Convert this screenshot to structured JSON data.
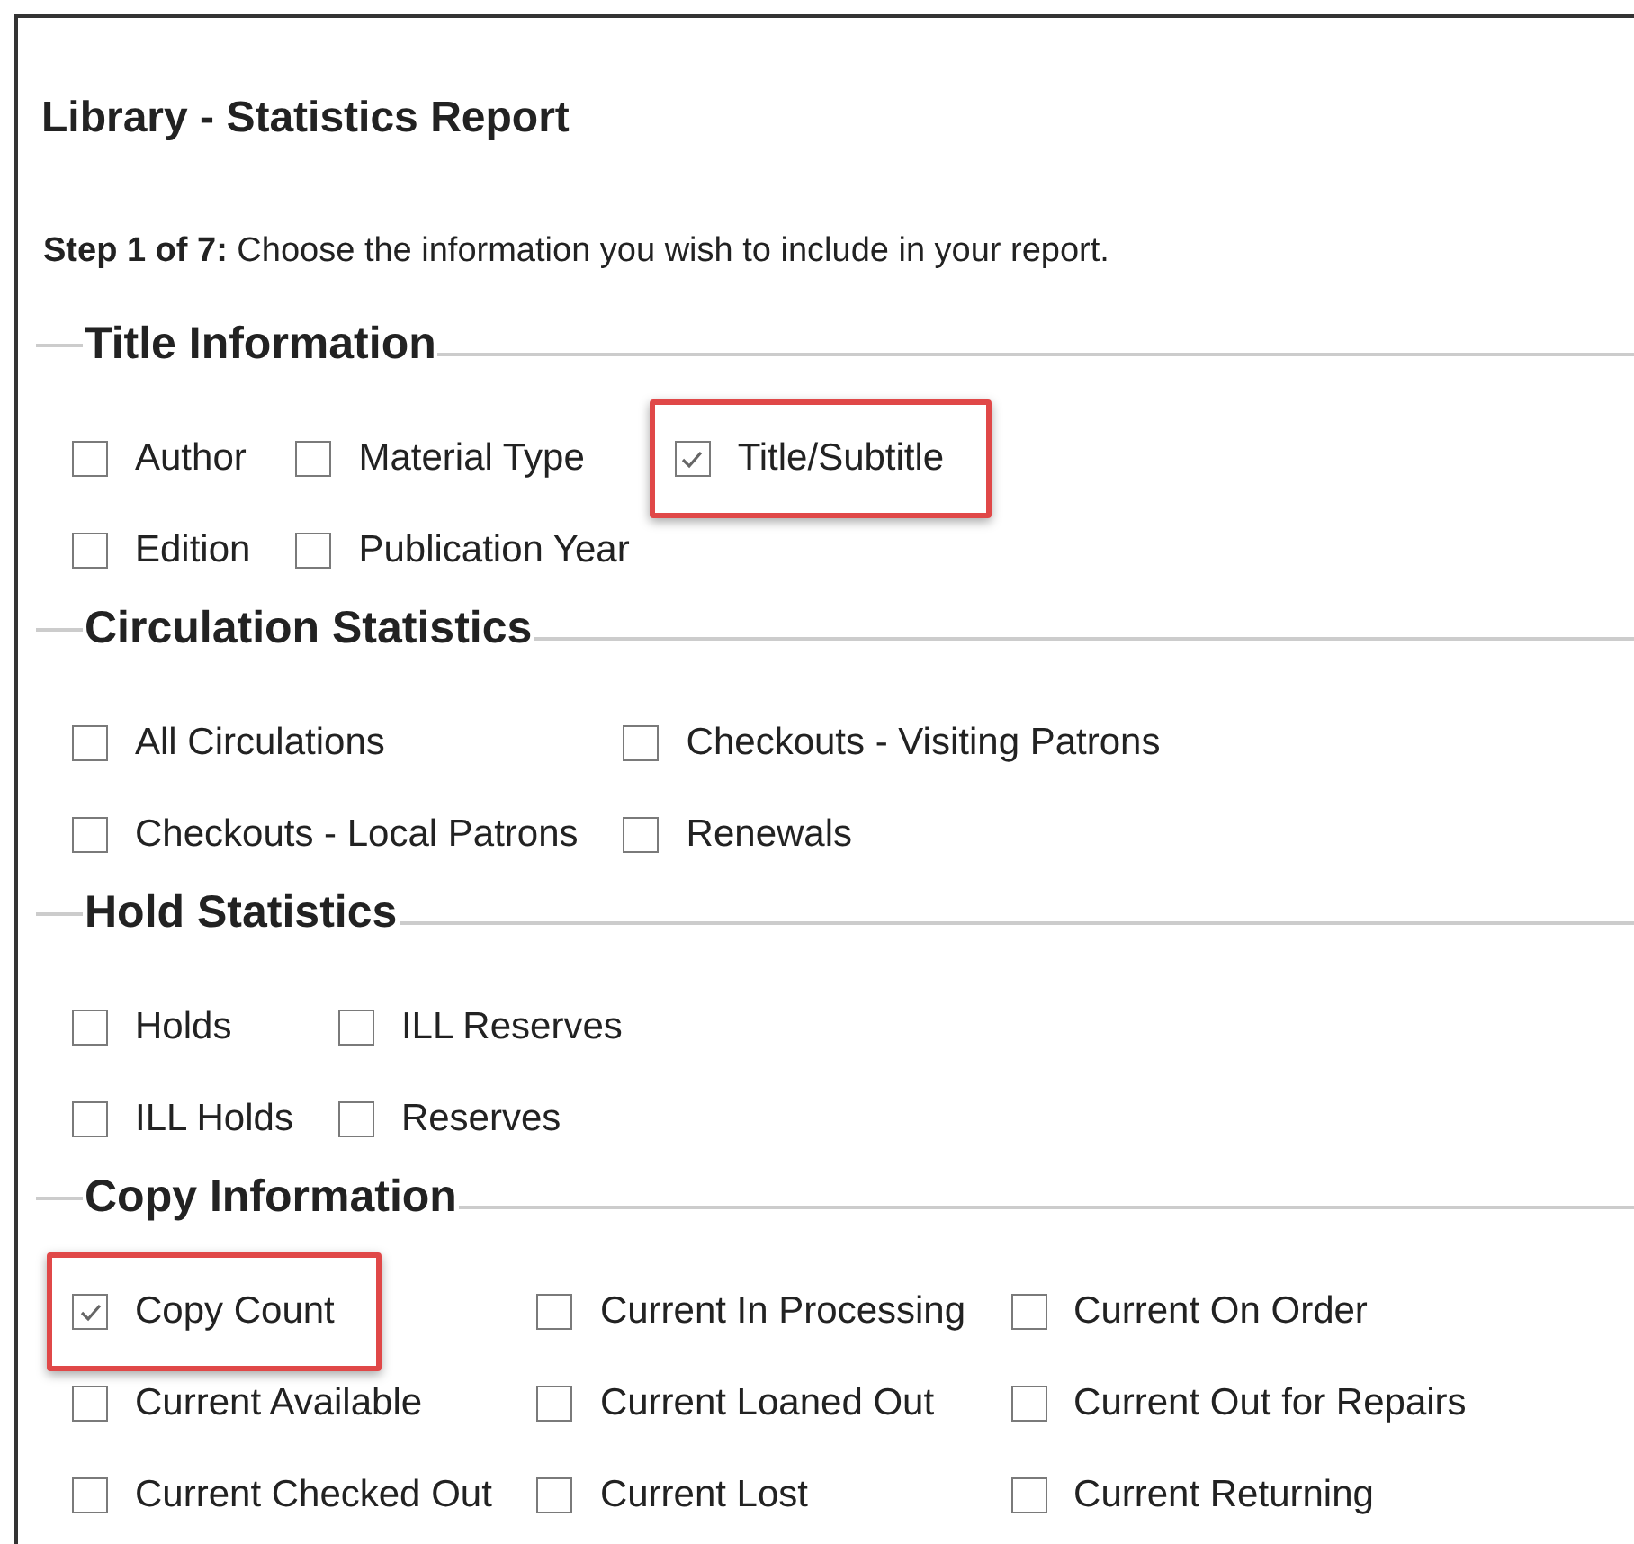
{
  "title": "Library - Statistics Report",
  "step_text": "**Step 1 of 7:** Choose the information you wish to include in your report.",
  "sections": [
    {
      "title": "Title Information",
      "rows": [
        [
          {
            "label": "Author",
            "checked": false,
            "highlighted": false
          },
          {
            "label": "Material Type",
            "checked": false,
            "highlighted": false
          },
          {
            "label": "Title/Subtitle",
            "checked": true,
            "highlighted": true
          }
        ],
        [
          {
            "label": "Edition",
            "checked": false,
            "highlighted": false
          },
          {
            "label": "Publication Year",
            "checked": false,
            "highlighted": false
          }
        ]
      ]
    },
    {
      "title": "Circulation Statistics",
      "rows": [
        [
          {
            "label": "All Circulations",
            "checked": false,
            "highlighted": false
          },
          {
            "label": "Checkouts - Visiting Patrons",
            "checked": false,
            "highlighted": false
          }
        ],
        [
          {
            "label": "Checkouts - Local Patrons",
            "checked": false,
            "highlighted": false
          },
          {
            "label": "Renewals",
            "checked": false,
            "highlighted": false
          }
        ]
      ]
    },
    {
      "title": "Hold Statistics",
      "rows": [
        [
          {
            "label": "Holds",
            "checked": false,
            "highlighted": false
          },
          {
            "label": "ILL Reserves",
            "checked": false,
            "highlighted": false
          }
        ],
        [
          {
            "label": "ILL Holds",
            "checked": false,
            "highlighted": false
          },
          {
            "label": "Reserves",
            "checked": false,
            "highlighted": false
          }
        ]
      ]
    },
    {
      "title": "Copy Information",
      "rows": [
        [
          {
            "label": "Copy Count",
            "checked": true,
            "highlighted": true
          },
          {
            "label": "Current In Processing",
            "checked": false,
            "highlighted": false
          },
          {
            "label": "Current On Order",
            "checked": false,
            "highlighted": false
          }
        ],
        [
          {
            "label": "Current Available",
            "checked": false,
            "highlighted": false
          },
          {
            "label": "Current Loaned Out",
            "checked": false,
            "highlighted": false
          },
          {
            "label": "Current Out for Repairs",
            "checked": false,
            "highlighted": false
          }
        ],
        [
          {
            "label": "Current Checked Out",
            "checked": false,
            "highlighted": false
          },
          {
            "label": "Current Lost",
            "checked": false,
            "highlighted": false
          },
          {
            "label": "Current Returning",
            "checked": false,
            "highlighted": false
          }
        ]
      ]
    }
  ]
}
